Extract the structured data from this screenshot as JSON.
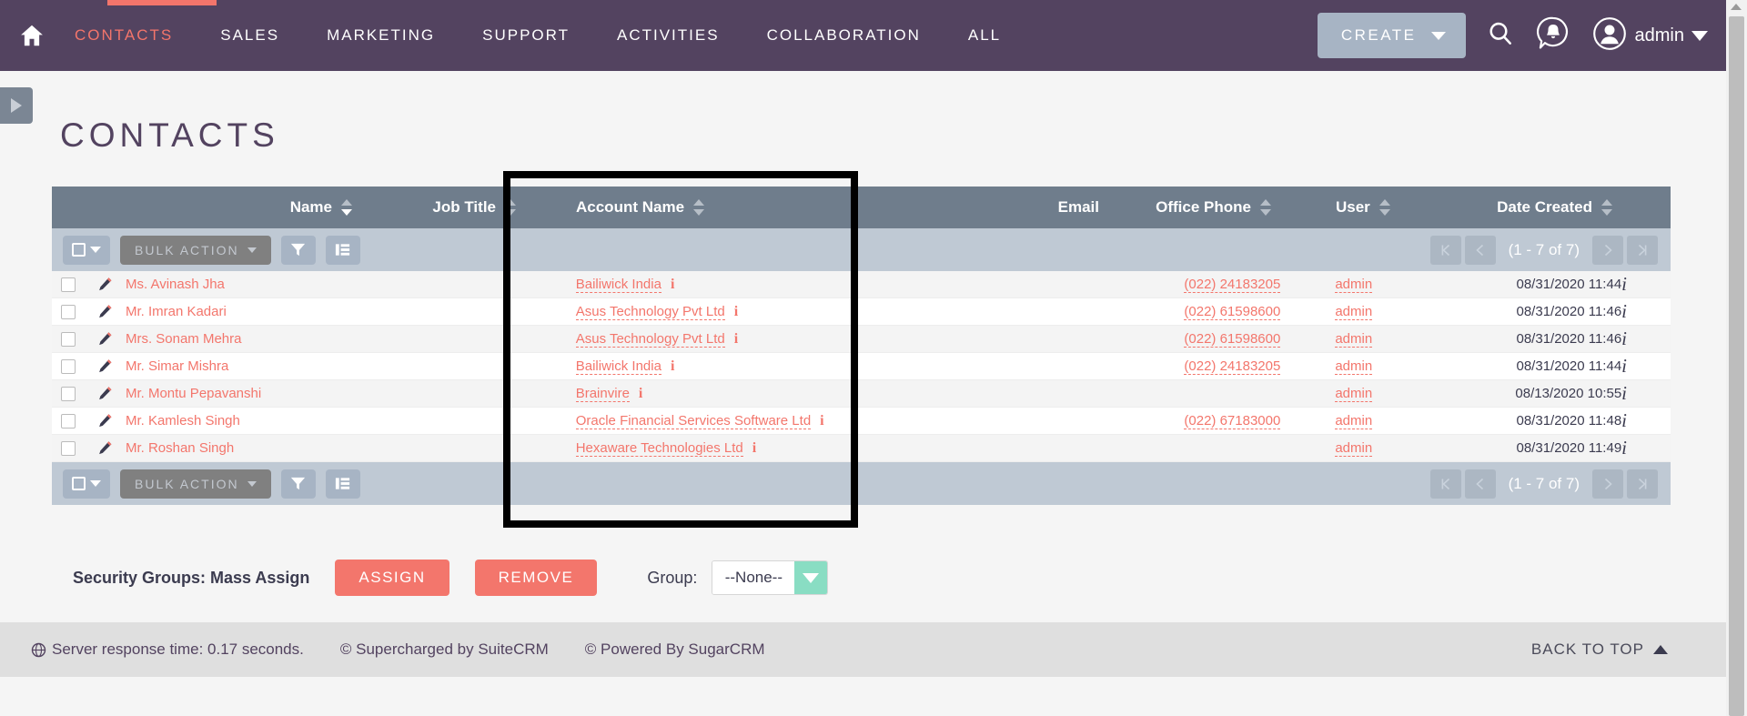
{
  "topnav": {
    "home_icon": "home-icon",
    "items": [
      {
        "label": "CONTACTS",
        "active": true
      },
      {
        "label": "SALES",
        "active": false
      },
      {
        "label": "MARKETING",
        "active": false
      },
      {
        "label": "SUPPORT",
        "active": false
      },
      {
        "label": "ACTIVITIES",
        "active": false
      },
      {
        "label": "COLLABORATION",
        "active": false
      },
      {
        "label": "ALL",
        "active": false
      }
    ],
    "create_label": "CREATE",
    "search_icon": "search-icon",
    "notification_icon": "notification-bell-icon",
    "avatar_icon": "user-avatar-icon",
    "admin_label": "admin",
    "accent_active": "#f3756b",
    "bar_color": "#534360"
  },
  "page": {
    "title": "CONTACTS"
  },
  "listview": {
    "columns": [
      {
        "key": "name",
        "label": "Name",
        "sortable": true,
        "sort_active": true
      },
      {
        "key": "job",
        "label": "Job Title",
        "sortable": true,
        "sort_active": false
      },
      {
        "key": "acct",
        "label": "Account Name",
        "sortable": true,
        "sort_active": false
      },
      {
        "key": "email",
        "label": "Email",
        "sortable": false,
        "sort_active": false
      },
      {
        "key": "phone",
        "label": "Office Phone",
        "sortable": true,
        "sort_active": false
      },
      {
        "key": "user",
        "label": "User",
        "sortable": true,
        "sort_active": false
      },
      {
        "key": "date",
        "label": "Date Created",
        "sortable": true,
        "sort_active": false
      }
    ],
    "toolbar": {
      "select_all_icon": "checkbox-dropdown-icon",
      "bulk_action_label": "BULK ACTION",
      "bulk_action_disabled": true,
      "filter_icon": "funnel-filter-icon",
      "columns_icon": "column-chooser-icon",
      "pager": {
        "first_icon": "page-first-icon",
        "prev_icon": "page-prev-icon",
        "label": "(1 - 7 of 7)",
        "next_icon": "page-next-icon",
        "last_icon": "page-last-icon"
      }
    },
    "rows": [
      {
        "name": "Ms. Avinash Jha",
        "job": "",
        "account": "Bailiwick India",
        "email": "",
        "phone": "(022) 24183205",
        "user": "admin",
        "date": "08/31/2020 11:44"
      },
      {
        "name": "Mr. Imran Kadari",
        "job": "",
        "account": "Asus Technology Pvt Ltd",
        "email": "",
        "phone": "(022) 61598600",
        "user": "admin",
        "date": "08/31/2020 11:46"
      },
      {
        "name": "Mrs. Sonam Mehra",
        "job": "",
        "account": "Asus Technology Pvt Ltd",
        "email": "",
        "phone": "(022) 61598600",
        "user": "admin",
        "date": "08/31/2020 11:46"
      },
      {
        "name": "Mr. Simar Mishra",
        "job": "",
        "account": "Bailiwick India",
        "email": "",
        "phone": "(022) 24183205",
        "user": "admin",
        "date": "08/31/2020 11:44"
      },
      {
        "name": "Mr. Montu Pepavanshi",
        "job": "",
        "account": "Brainvire",
        "email": "",
        "phone": "",
        "user": "admin",
        "date": "08/13/2020 10:55"
      },
      {
        "name": "Mr. Kamlesh Singh",
        "job": "",
        "account": "Oracle Financial Services Software Ltd",
        "email": "",
        "phone": "(022) 67183000",
        "user": "admin",
        "date": "08/31/2020 11:48"
      },
      {
        "name": "Mr. Roshan Singh",
        "job": "",
        "account": "Hexaware Technologies Ltd",
        "email": "",
        "phone": "",
        "user": "admin",
        "date": "08/31/2020 11:49"
      }
    ],
    "row_info_icon": "row-info-icon",
    "account_info_icon": "account-info-icon",
    "edit_icon": "edit-pencil-icon"
  },
  "security_groups": {
    "label": "Security Groups: Mass Assign",
    "assign_label": "ASSIGN",
    "remove_label": "REMOVE",
    "group_label": "Group:",
    "group_value": "--None--",
    "dropdown_icon": "chevron-down-icon"
  },
  "footer": {
    "globe_icon": "globe-icon",
    "server_time": "Server response time: 0.17 seconds.",
    "supercharged": "© Supercharged by SuiteCRM",
    "powered": "© Powered By SugarCRM",
    "back_to_top": "BACK TO TOP"
  },
  "highlight": {
    "target_column": "Account Name",
    "color": "#000000"
  },
  "sidebar_toggle": {
    "icon": "sidebar-expand-icon"
  }
}
